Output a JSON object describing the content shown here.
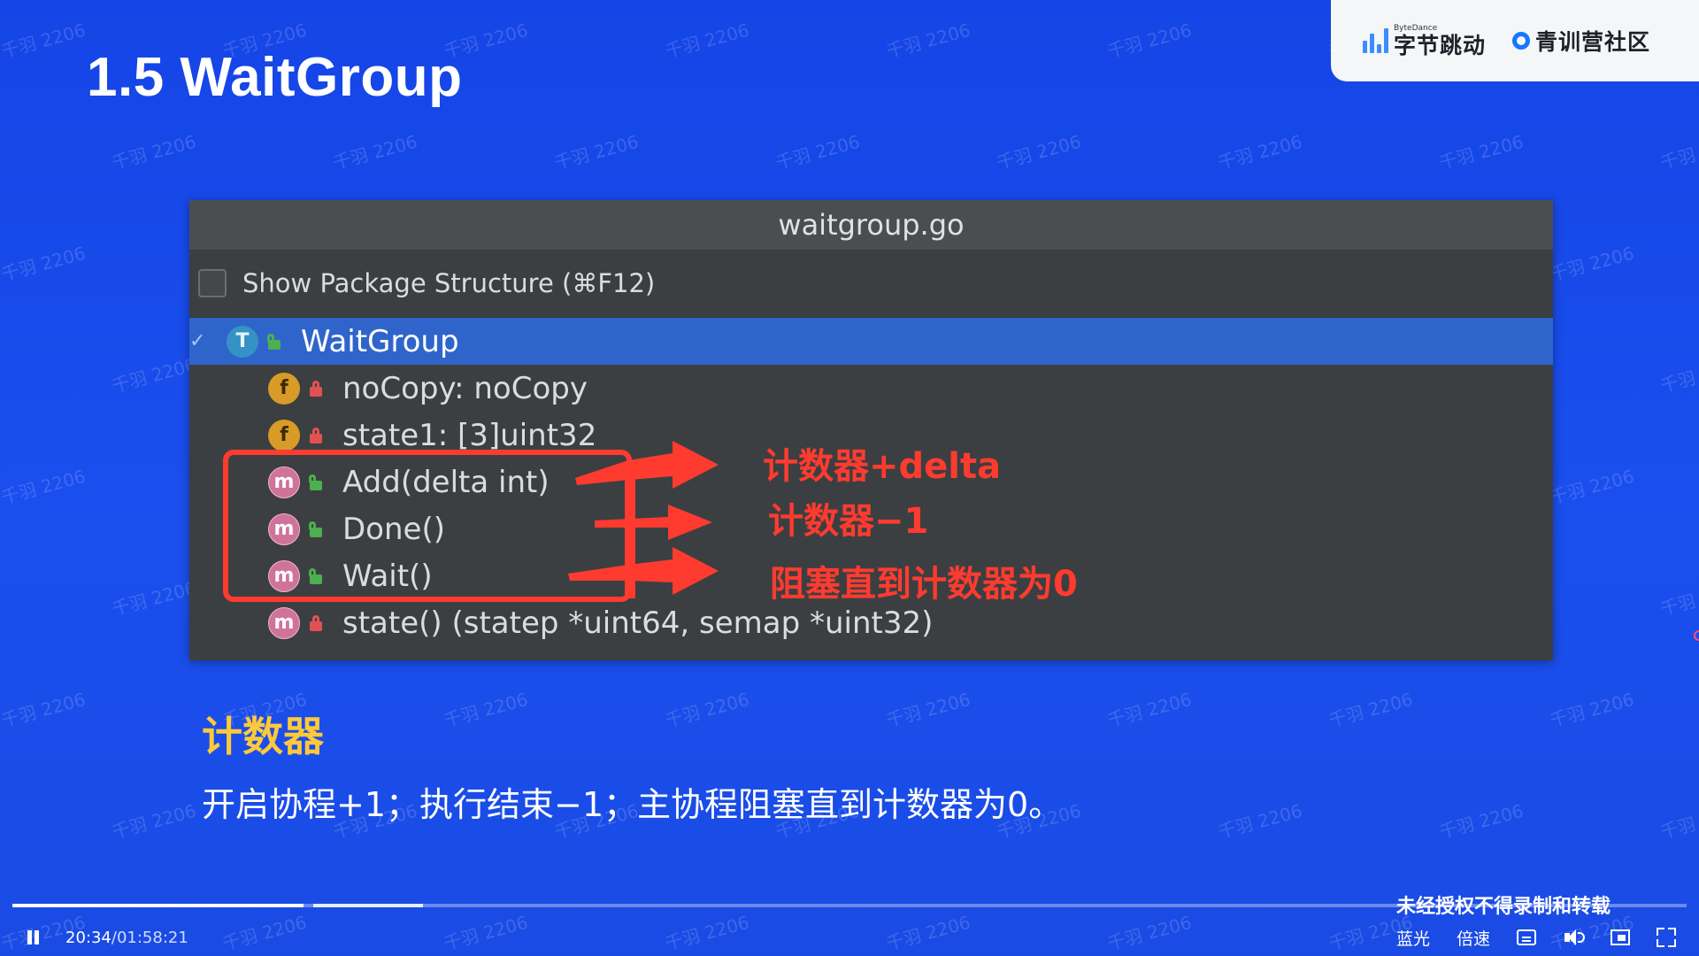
{
  "slide": {
    "title": "1.5 WaitGroup"
  },
  "logos": {
    "bytedance_small": "ByteDance",
    "bytedance_name": "字节跳动",
    "community_name": "青训营社区",
    "brand_color": "#3c8cff"
  },
  "ide": {
    "file_title": "waitgroup.go",
    "option_label": "Show Package Structure (⌘F12)",
    "option_checked": false,
    "tree": [
      {
        "kind": "T",
        "access": "public",
        "label": "WaitGroup",
        "selected": true,
        "expanded": true
      },
      {
        "kind": "f",
        "access": "private",
        "label": "noCopy: noCopy"
      },
      {
        "kind": "f",
        "access": "private",
        "label": "state1: [3]uint32"
      },
      {
        "kind": "m",
        "access": "public",
        "label": "Add(delta int)"
      },
      {
        "kind": "m",
        "access": "public",
        "label": "Done()"
      },
      {
        "kind": "m",
        "access": "public",
        "label": "Wait()"
      },
      {
        "kind": "m",
        "access": "private",
        "label": "state() (statep *uint64, semap *uint32)"
      }
    ]
  },
  "annotations": {
    "add": "计数器+delta",
    "done": "计数器−1",
    "wait": "阻塞直到计数器为0",
    "color": "#ff3b30"
  },
  "section": {
    "heading": "计数器",
    "description": "开启协程+1；执行结束−1；主协程阻塞直到计数器为0。",
    "heading_color": "#ffc93a"
  },
  "watermark_text": "千羽 2206",
  "notice": "未经授权不得录制和转载",
  "player": {
    "current_time": "20:34",
    "total_time": "/01:58:21",
    "progress_fraction": 0.174,
    "quality_label": "蓝光",
    "speed_label": "倍速",
    "icons": [
      "pause-icon",
      "subtitle-icon",
      "volume-icon",
      "pip-icon",
      "fullscreen-icon"
    ]
  }
}
